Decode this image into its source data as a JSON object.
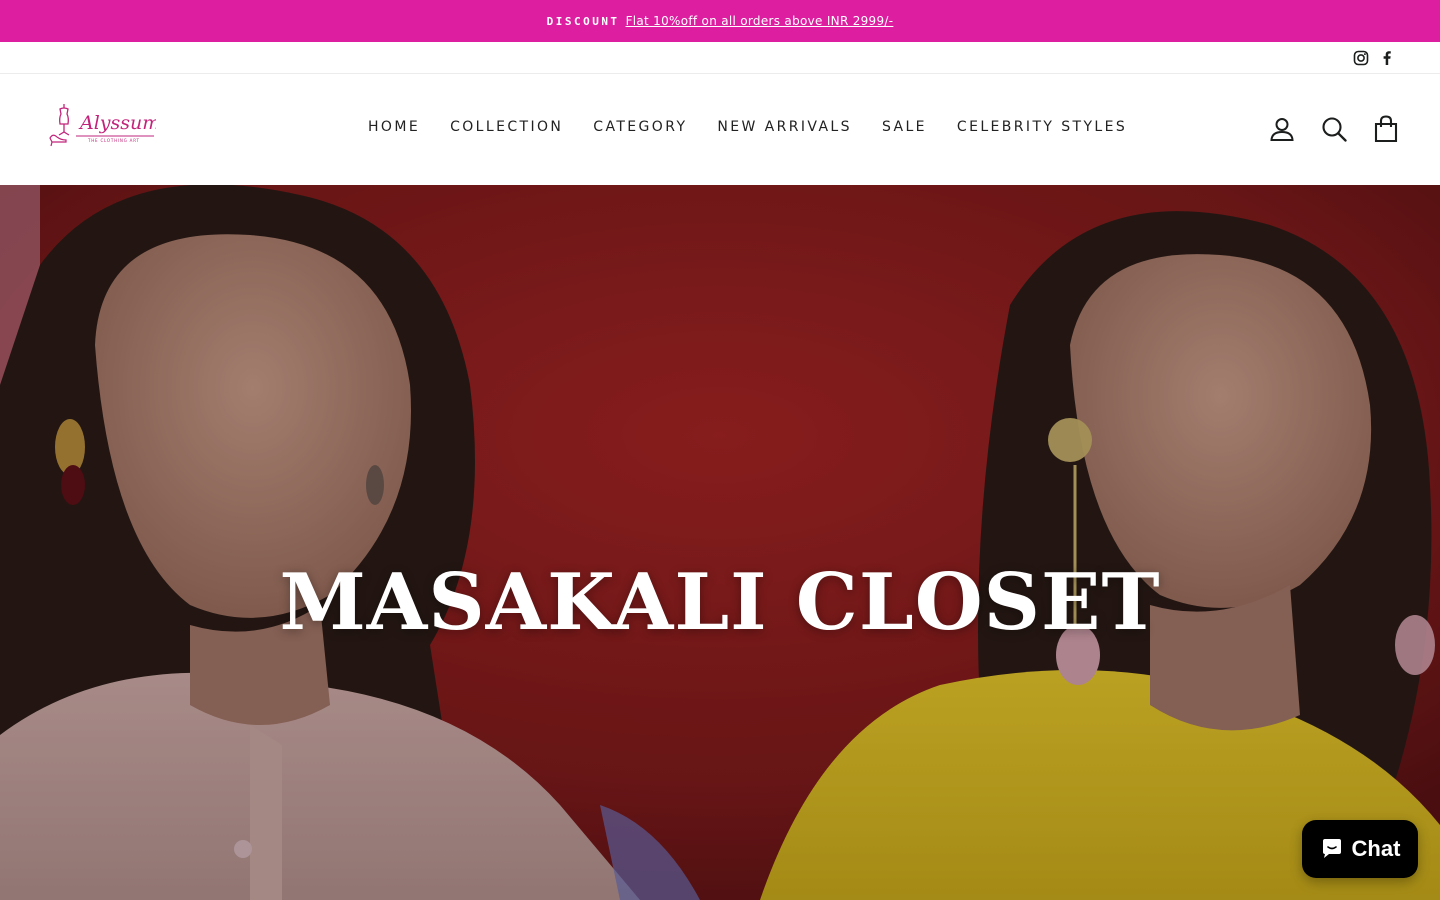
{
  "announcement": {
    "label": "DISCOUNT",
    "link_text": "Flat 10%off on all orders above INR 2999/-",
    "background": "#de1ea1"
  },
  "social": {
    "items": [
      {
        "icon": "instagram-icon"
      },
      {
        "icon": "facebook-icon"
      }
    ]
  },
  "header": {
    "logo": {
      "name": "Alyssum",
      "tagline": "THE CLOTHING ART",
      "color": "#c2247c"
    },
    "nav": [
      "HOME",
      "COLLECTION",
      "CATEGORY",
      "NEW ARRIVALS",
      "SALE",
      "CELEBRITY STYLES"
    ],
    "icons": [
      {
        "icon": "account-icon",
        "label": "Log in"
      },
      {
        "icon": "search-icon",
        "label": "Search"
      },
      {
        "icon": "cart-icon",
        "label": "Cart"
      }
    ]
  },
  "hero": {
    "title": "MASAKALI CLOSET",
    "colors": {
      "backdrop": "#8e1c1e",
      "left_top": "#d8b4b0",
      "right_top": "#e4c52a"
    }
  },
  "chat_widget": {
    "label": "Chat",
    "icon": "chat-bubble-icon"
  }
}
